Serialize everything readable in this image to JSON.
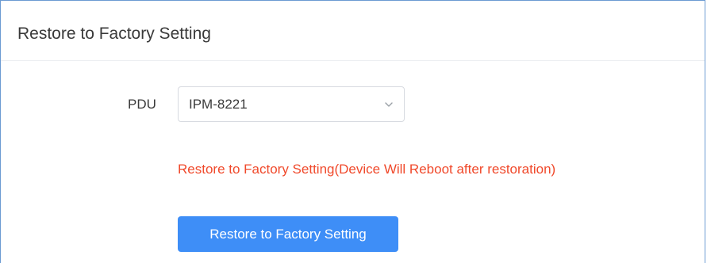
{
  "panel": {
    "title": "Restore to Factory Setting"
  },
  "form": {
    "pdu_label": "PDU",
    "pdu_selected": "IPM-8221",
    "warning": "Restore to Factory Setting(Device Will Reboot after restoration)",
    "restore_button_label": "Restore to Factory Setting"
  },
  "icons": {
    "select_arrow": "chevron-down-icon"
  },
  "colors": {
    "button_bg": "#3e8ef7",
    "warning_text": "#f0492b",
    "frame_border": "#6c9bd2"
  }
}
